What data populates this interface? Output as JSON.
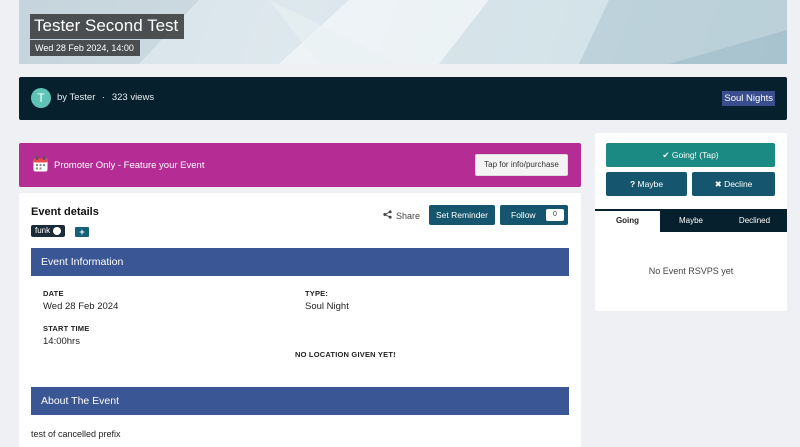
{
  "hero": {
    "title": "Tester Second Test",
    "date": "Wed 28 Feb 2024, 14:00"
  },
  "meta": {
    "avatar_letter": "T",
    "by": "by Tester",
    "separator": "·",
    "views": "323 views",
    "category": "Soul Nights"
  },
  "promo": {
    "icon": "calendar-icon",
    "text": "Promoter Only - Feature your Event",
    "button": "Tap for info/purchase"
  },
  "event_details": {
    "title": "Event details",
    "tags": [
      "funk"
    ],
    "add_tag": "+",
    "share": "Share",
    "set_reminder": "Set Reminder",
    "follow": "Follow",
    "follow_count": "0"
  },
  "info": {
    "heading": "Event Information",
    "date_label": "DATE",
    "date_value": "Wed 28 Feb 2024",
    "type_label": "TYPE:",
    "type_value": "Soul Night",
    "start_label": "START TIME",
    "start_value": "14:00hrs",
    "location": "NO LOCATION GIVEN YET!"
  },
  "about": {
    "heading": "About The Event",
    "text": "test of cancelled prefix"
  },
  "rsvp": {
    "going": "Going! (Tap)",
    "maybe": "Maybe",
    "decline": "Decline",
    "tabs": [
      "Going",
      "Maybe",
      "Declined"
    ],
    "active_tab": "Going",
    "empty": "No Event RSVPS yet"
  },
  "colors": {
    "promo": "#b42c94",
    "section": "#3a5694",
    "primary_button": "#15566e",
    "going_button": "#1b8a83",
    "bar": "#06202d"
  }
}
